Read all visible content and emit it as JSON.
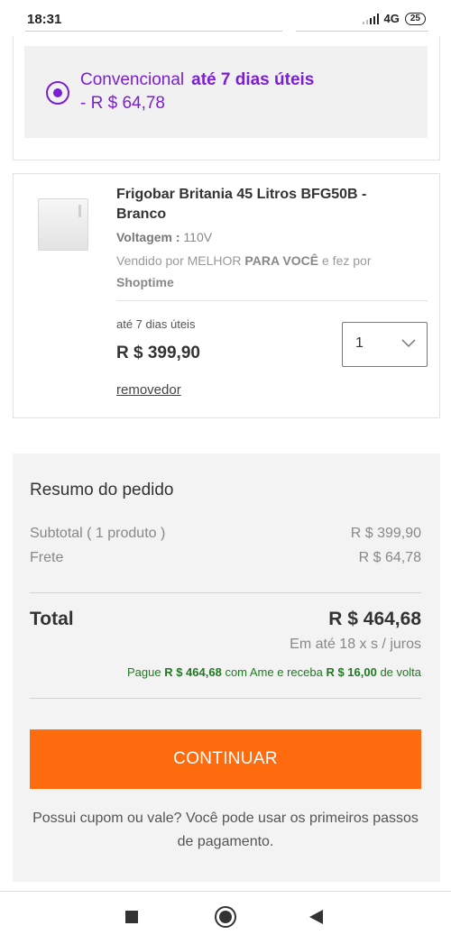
{
  "status_bar": {
    "time": "18:31",
    "network": "4G",
    "battery": "25"
  },
  "shipping": {
    "option_name": "Convencional",
    "option_time": "até 7 dias úteis",
    "option_price": "- R $ 64,78",
    "selected": true,
    "accent_color": "#7a1fd1"
  },
  "product": {
    "title": "Frigobar Britania 45 Litros BFG50B - Branco",
    "voltage_label": "Voltagem :",
    "voltage_value": "110V",
    "seller_prefix": "Vendido por MELHOR",
    "seller_bold": "PARA VOCÊ",
    "seller_suffix": "e fez por",
    "fulfilled_by": "Shoptime",
    "delivery": "até 7 dias úteis",
    "price": "R $ 399,90",
    "quantity": "1",
    "remove_label": "removedor"
  },
  "summary": {
    "title": "Resumo do pedido",
    "subtotal_label": "Subtotal ( 1 produto )",
    "subtotal_value": "R $ 399,90",
    "shipping_label": "Frete",
    "shipping_value": "R $ 64,78",
    "total_label": "Total",
    "total_value": "R $ 464,68",
    "installments": "Em até 18 x s / juros",
    "ame_pay": "Pague",
    "ame_amount": "R $ 464,68",
    "ame_mid": "com Ame e receba",
    "ame_cashback": "R $ 16,00",
    "ame_end": "de volta",
    "continue_label": "CONTINUAR",
    "coupon_text": "Possui cupom ou vale? Você pode usar os primeiros passos de pagamento."
  },
  "colors": {
    "primary_button": "#ff6b0f",
    "cashback_green": "#1f7a1f"
  },
  "nav": {
    "icons": [
      "recent-apps-icon",
      "home-icon",
      "back-icon"
    ]
  }
}
